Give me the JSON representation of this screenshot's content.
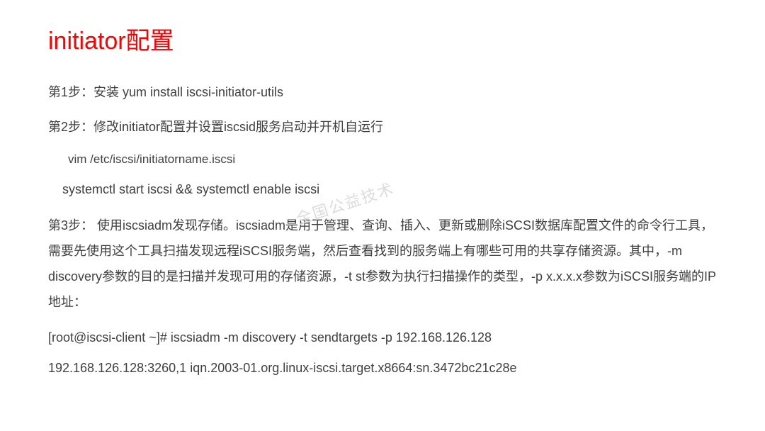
{
  "title": "initiator配置",
  "step1": "第1步：安装  yum install iscsi-initiator-utils",
  "step2": "第2步：修改initiator配置并设置iscsid服务启动并开机自运行",
  "vim_cmd": "vim /etc/iscsi/initiatorname.iscsi",
  "systemctl_cmd": "systemctl start iscsi  && systemctl enable iscsi",
  "step3_para": "第3步：  使用iscsiadm发现存储。iscsiadm是用于管理、查询、插入、更新或删除iSCSI数据库配置文件的命令行工具，需要先使用这个工具扫描发现远程iSCSI服务端，然后查看找到的服务端上有哪些可用的共享存储资源。其中，-m discovery参数的目的是扫描并发现可用的存储资源，-t st参数为执行扫描操作的类型，-p x.x.x.x参数为iSCSI服务端的IP地址：",
  "discovery_cmd": "[root@iscsi-client ~]# iscsiadm -m discovery -t sendtargets -p 192.168.126.128",
  "discovery_output": "192.168.126.128:3260,1 iqn.2003-01.org.linux-iscsi.target.x8664:sn.3472bc21c28e",
  "watermark": "全国公益技术"
}
